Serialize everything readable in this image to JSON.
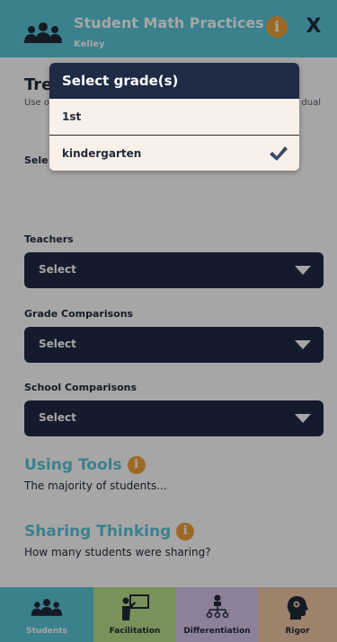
{
  "header": {
    "title": "Student Math Practices",
    "subtitle": "Kelley",
    "info_label": "i",
    "close_label": "X",
    "icons": {
      "group": "group-icon",
      "info": "info-icon",
      "close": "close-icon"
    }
  },
  "trends": {
    "title": "Tre",
    "description": "Use obse grad",
    "description_tail": "dual",
    "select_label": "Sele"
  },
  "fields": {
    "teachers": {
      "label": "Teachers",
      "value": "Select"
    },
    "grade_comparisons": {
      "label": "Grade Comparisons",
      "value": "Select"
    },
    "school_comparisons": {
      "label": "School Comparisons",
      "value": "Select"
    }
  },
  "sections": {
    "using_tools": {
      "title": "Using Tools",
      "info_label": "i",
      "description": "The majority of students..."
    },
    "sharing_thinking": {
      "title": "Sharing Thinking",
      "info_label": "i",
      "description": "How many students were sharing?"
    }
  },
  "bottom_nav": {
    "tabs": [
      {
        "label": "Students",
        "icon": "students-icon",
        "color": "#5ac6d9"
      },
      {
        "label": "Facilitation",
        "icon": "teacher-board-icon",
        "color": "#b9e08a"
      },
      {
        "label": "Differentiation",
        "icon": "hierarchy-icon",
        "color": "#d9c5ec"
      },
      {
        "label": "Rigor",
        "icon": "head-gear-icon",
        "color": "#f2c8a6"
      }
    ]
  },
  "grade_modal": {
    "title": "Select grade(s)",
    "options": [
      {
        "label": "1st",
        "selected": false
      },
      {
        "label": "kindergarten",
        "selected": true
      }
    ]
  },
  "colors": {
    "accent": "#5ac6d9",
    "dark": "#1f2a44",
    "info": "#f2a33a"
  }
}
